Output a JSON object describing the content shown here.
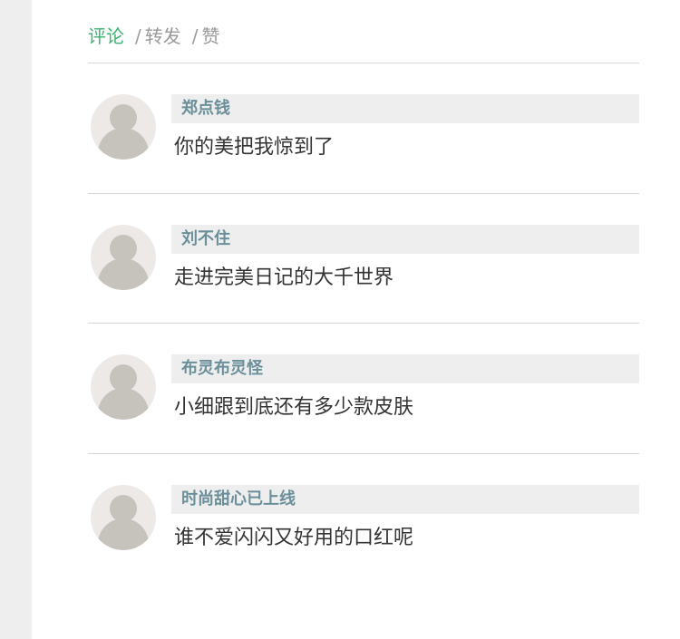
{
  "tabs": [
    {
      "label": "评论",
      "active": true
    },
    {
      "label": "转发",
      "active": false
    },
    {
      "label": "赞",
      "active": false
    }
  ],
  "tab_separator": "/",
  "comments": [
    {
      "author": "郑点钱",
      "text": "你的美把我惊到了"
    },
    {
      "author": "刘不住",
      "text": "走进完美日记的大千世界"
    },
    {
      "author": "布灵布灵怪",
      "text": "小细跟到底还有多少款皮肤"
    },
    {
      "author": "时尚甜心已上线",
      "text": "谁不爱闪闪又好用的口红呢"
    }
  ],
  "colors": {
    "active_tab": "#3cb371",
    "inactive_tab": "#9a9a9a",
    "author_name": "#6b8f9a",
    "name_bar_bg": "#eeeeee",
    "avatar_bg": "#ede9e6",
    "avatar_silhouette": "#c6c3bd",
    "left_strip": "#eeeeee"
  },
  "icons": {
    "avatar": "default-user-avatar-icon"
  }
}
